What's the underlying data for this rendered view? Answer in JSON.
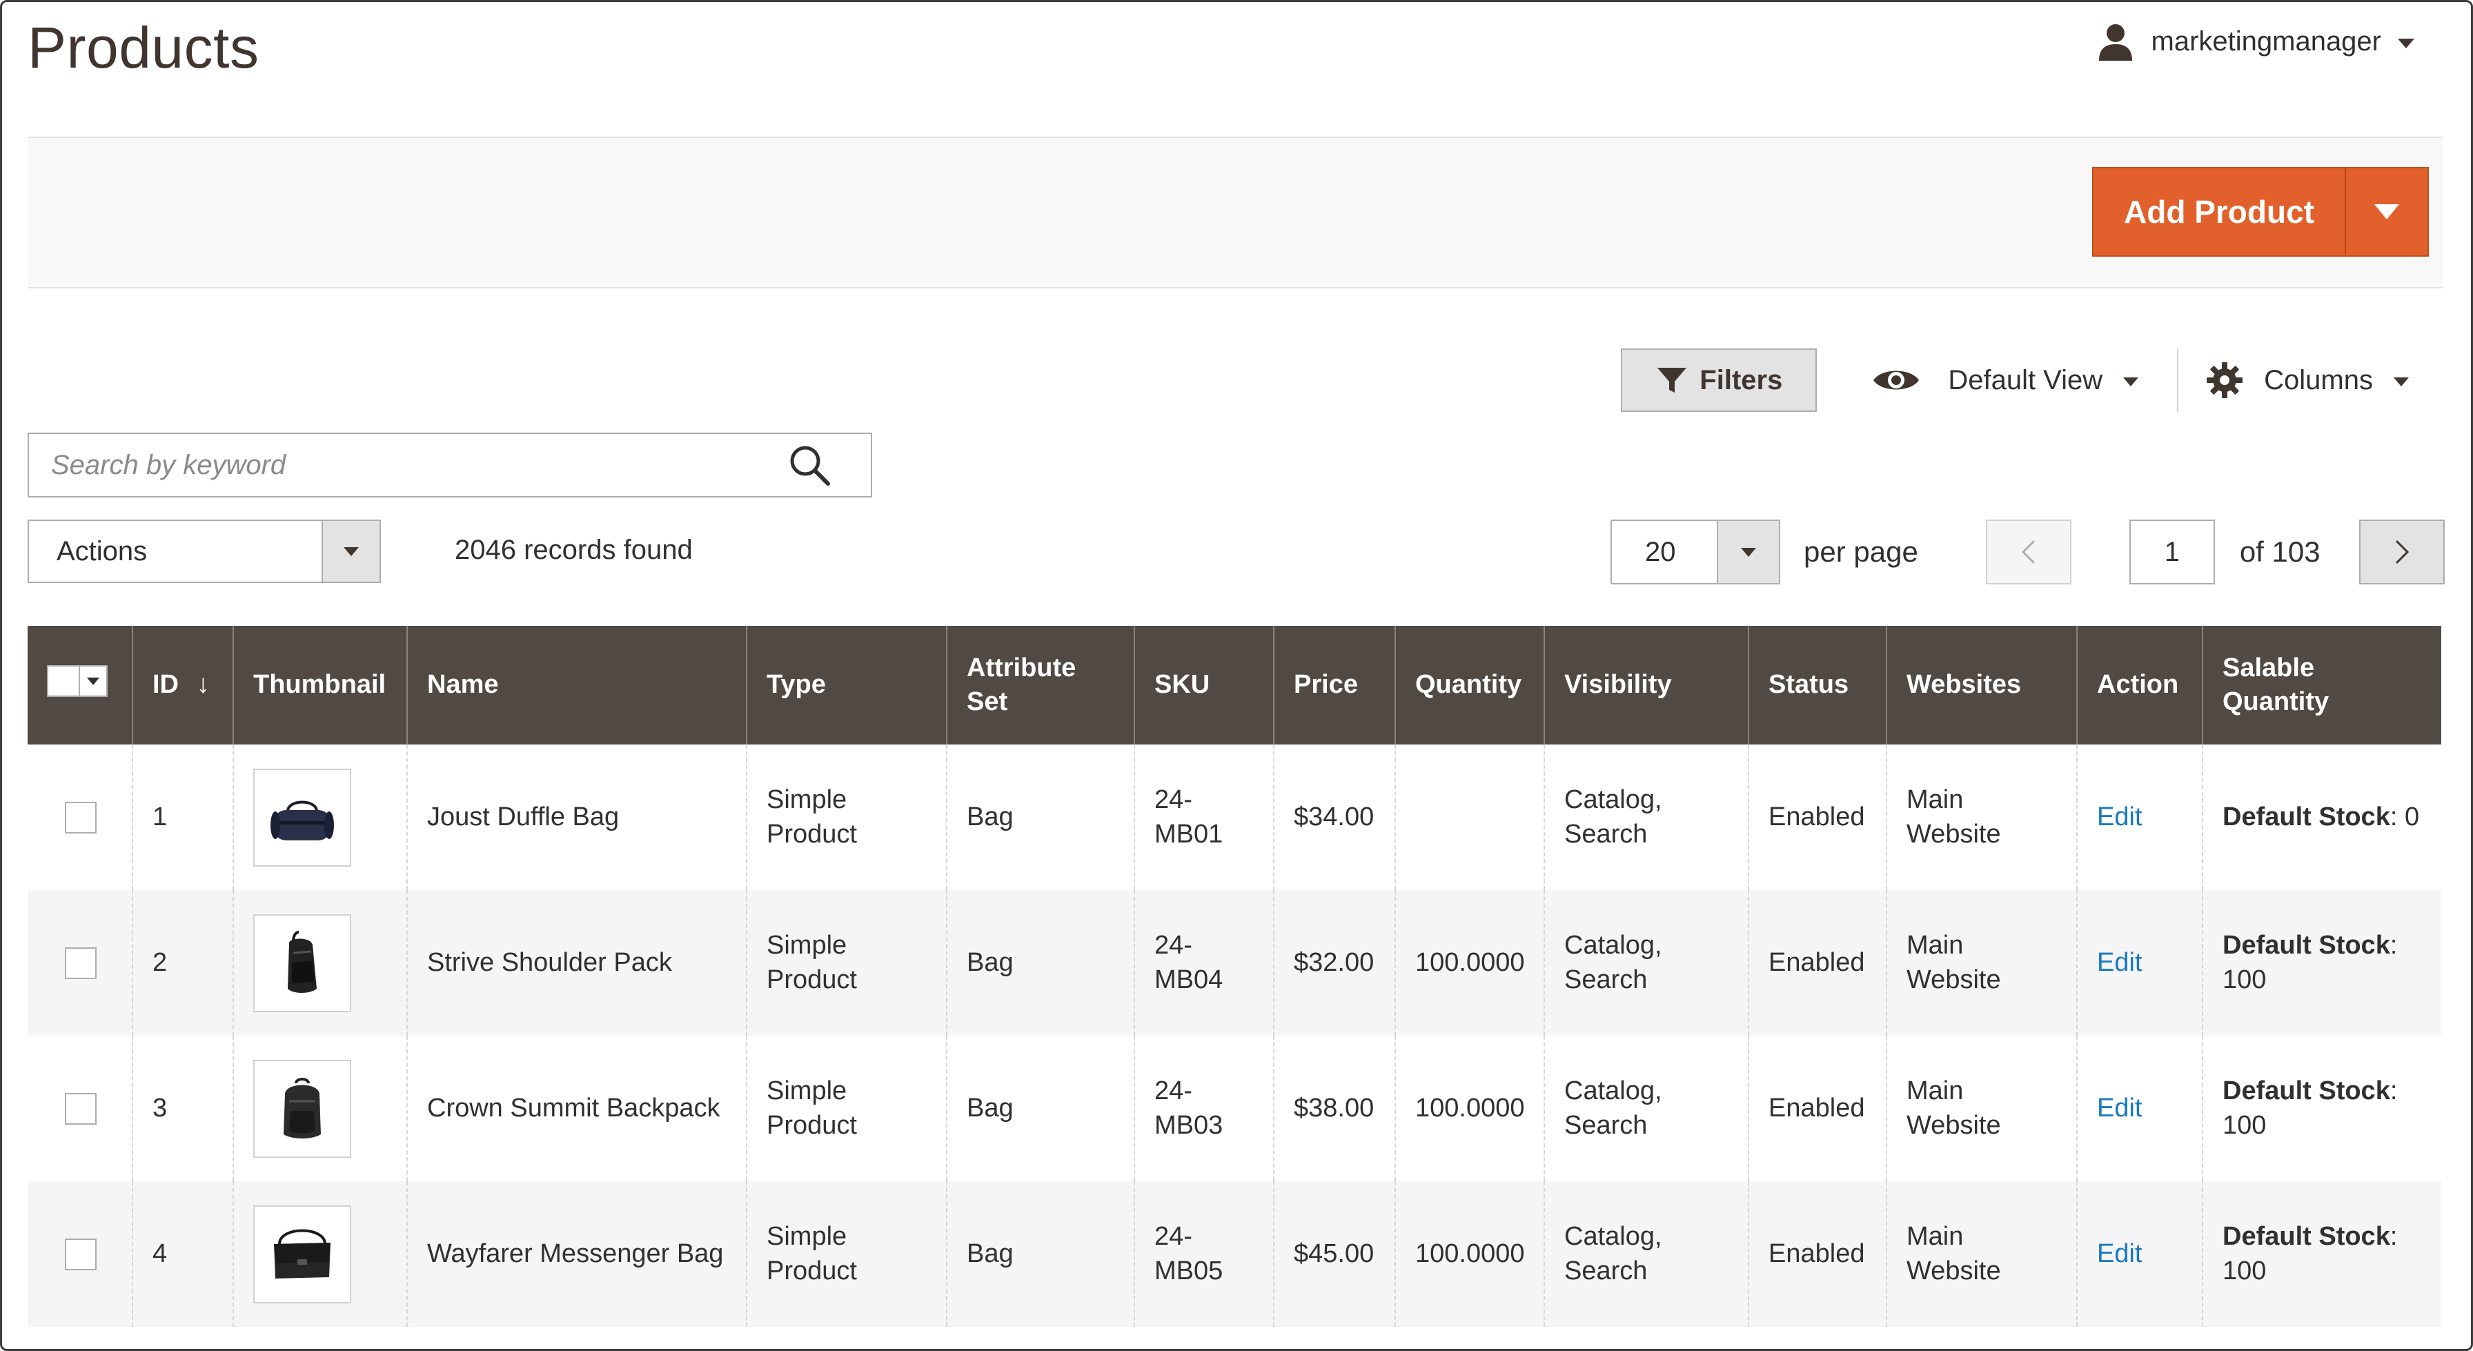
{
  "page": {
    "title": "Products"
  },
  "user": {
    "name": "marketingmanager",
    "icon": "user-icon"
  },
  "add_product": {
    "label": "Add Product",
    "brand_color": "#e1602b"
  },
  "toolbar": {
    "filters_label": "Filters",
    "view_label": "Default View",
    "columns_label": "Columns"
  },
  "search": {
    "placeholder": "Search by keyword"
  },
  "actions": {
    "label": "Actions"
  },
  "records": {
    "text": "2046 records found"
  },
  "pager": {
    "per_page_value": "20",
    "per_page_label": "per page",
    "current_page": "1",
    "total_label": "of 103"
  },
  "grid": {
    "headers": {
      "id": "ID",
      "sort_indicator": "↓",
      "thumbnail": "Thumbnail",
      "name": "Name",
      "type": "Type",
      "attribute_set": "Attribute Set",
      "sku": "SKU",
      "price": "Price",
      "quantity": "Quantity",
      "visibility": "Visibility",
      "status": "Status",
      "websites": "Websites",
      "action": "Action",
      "salable_quantity": "Salable Quantity"
    },
    "rows": [
      {
        "id": "1",
        "thumbnail": "duffle-bag-thumbnail",
        "name": "Joust Duffle Bag",
        "type": "Simple Product",
        "attribute_set": "Bag",
        "sku": "24-MB01",
        "price": "$34.00",
        "quantity": "",
        "visibility": "Catalog, Search",
        "status": "Enabled",
        "websites": "Main Website",
        "action": "Edit",
        "salable_label": "Default Stock",
        "salable_value": ": 0"
      },
      {
        "id": "2",
        "thumbnail": "shoulder-pack-thumbnail",
        "name": "Strive Shoulder Pack",
        "type": "Simple Product",
        "attribute_set": "Bag",
        "sku": "24-MB04",
        "price": "$32.00",
        "quantity": "100.0000",
        "visibility": "Catalog, Search",
        "status": "Enabled",
        "websites": "Main Website",
        "action": "Edit",
        "salable_label": "Default Stock",
        "salable_value": ": 100"
      },
      {
        "id": "3",
        "thumbnail": "backpack-thumbnail",
        "name": "Crown Summit Backpack",
        "type": "Simple Product",
        "attribute_set": "Bag",
        "sku": "24-MB03",
        "price": "$38.00",
        "quantity": "100.0000",
        "visibility": "Catalog, Search",
        "status": "Enabled",
        "websites": "Main Website",
        "action": "Edit",
        "salable_label": "Default Stock",
        "salable_value": ": 100"
      },
      {
        "id": "4",
        "thumbnail": "messenger-bag-thumbnail",
        "name": "Wayfarer Messenger Bag",
        "type": "Simple Product",
        "attribute_set": "Bag",
        "sku": "24-MB05",
        "price": "$45.00",
        "quantity": "100.0000",
        "visibility": "Catalog, Search",
        "status": "Enabled",
        "websites": "Main Website",
        "action": "Edit",
        "salable_label": "Default Stock",
        "salable_value": ": 100"
      }
    ]
  },
  "colors": {
    "header_bg": "#514943",
    "link": "#1979c3",
    "title": "#41362f"
  }
}
